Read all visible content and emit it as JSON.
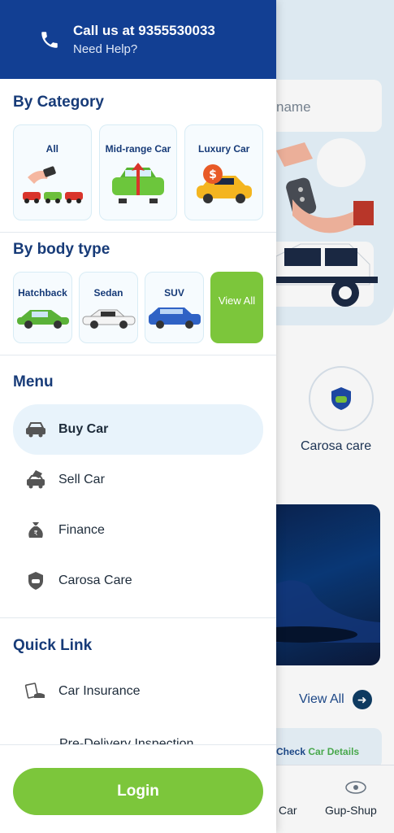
{
  "drawer": {
    "header": {
      "call_text": "Call us at 9355530033",
      "help_text": "Need Help?",
      "icon": "phone-icon"
    },
    "by_category": {
      "title": "By Category",
      "items": [
        {
          "label": "All"
        },
        {
          "label": "Mid-range Car"
        },
        {
          "label": "Luxury Car"
        }
      ]
    },
    "by_body_type": {
      "title": "By body type",
      "items": [
        {
          "label": "Hatchback"
        },
        {
          "label": "Sedan"
        },
        {
          "label": "SUV"
        }
      ],
      "view_all": "View All"
    },
    "menu": {
      "title": "Menu",
      "items": [
        {
          "label": "Buy Car",
          "icon": "car-icon"
        },
        {
          "label": "Sell Car",
          "icon": "sell-car-icon"
        },
        {
          "label": "Finance",
          "icon": "finance-bag-icon"
        },
        {
          "label": "Carosa Care",
          "icon": "care-icon"
        }
      ]
    },
    "quick_link": {
      "title": "Quick Link",
      "items": [
        {
          "label": "Car Insurance",
          "icon": "insurance-icon"
        },
        {
          "label": "Pre-Delivery Inspection",
          "icon": "inspection-icon"
        }
      ]
    },
    "login": "Login"
  },
  "background": {
    "search_placeholder": "name",
    "carosa_care": "Carosa care",
    "view_all": "View All",
    "check_label": "Check",
    "car_details_label": "Car Details",
    "nav_car": "Car",
    "nav_gup_shup": "Gup-Shup"
  },
  "colors": {
    "brand_blue": "#123f93",
    "accent_green": "#7cc63b",
    "active_bg": "#e8f3fb"
  }
}
